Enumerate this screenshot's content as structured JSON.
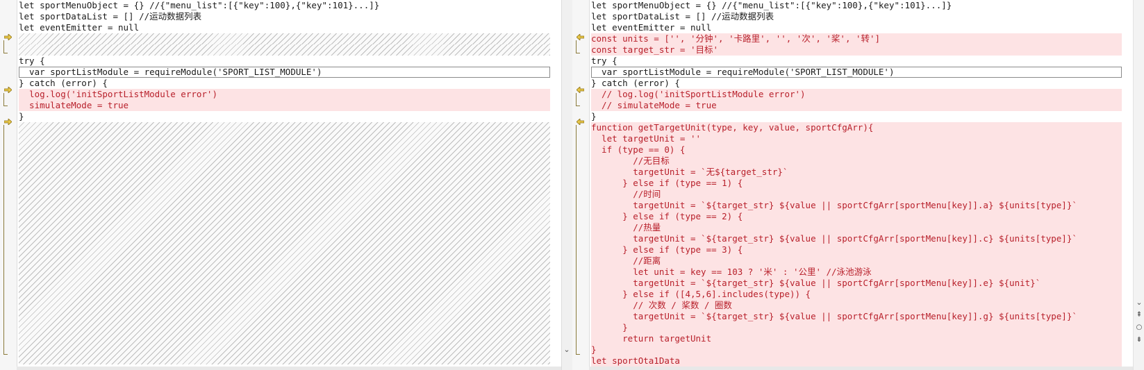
{
  "left": {
    "lines": [
      {
        "kind": "normal",
        "text": "let sportMenuObject = {} //{\"menu_list\":[{\"key\":100},{\"key\":101}...]}"
      },
      {
        "kind": "normal",
        "text": "let sportDataList = [] //运动数据列表"
      },
      {
        "kind": "normal",
        "text": "let eventEmitter = null"
      },
      {
        "kind": "filler",
        "text": ""
      },
      {
        "kind": "filler",
        "text": ""
      },
      {
        "kind": "normal",
        "text": "try {"
      },
      {
        "kind": "cursor",
        "text": "  var sportListModule = requireModule('SPORT_LIST_MODULE')"
      },
      {
        "kind": "normal",
        "text": "} catch (error) {"
      },
      {
        "kind": "diff",
        "text": "  log.log('initSportListModule error')"
      },
      {
        "kind": "diff",
        "text": "  simulateMode = true"
      },
      {
        "kind": "normal",
        "text": "}"
      },
      {
        "kind": "filler-big",
        "text": ""
      }
    ]
  },
  "right": {
    "lines": [
      {
        "kind": "normal",
        "text": "let sportMenuObject = {} //{\"menu_list\":[{\"key\":100},{\"key\":101}...]}"
      },
      {
        "kind": "normal",
        "text": "let sportDataList = [] //运动数据列表"
      },
      {
        "kind": "normal",
        "text": "let eventEmitter = null"
      },
      {
        "kind": "diff",
        "text": "const units = ['', '分钟', '卡路里', '', '次', '桨', '转']"
      },
      {
        "kind": "diff",
        "text": "const target_str = '目标'"
      },
      {
        "kind": "normal",
        "text": "try {"
      },
      {
        "kind": "cursor",
        "text": "  var sportListModule = requireModule('SPORT_LIST_MODULE')"
      },
      {
        "kind": "normal",
        "text": "} catch (error) {"
      },
      {
        "kind": "diff",
        "text": "  // log.log('initSportListModule error')"
      },
      {
        "kind": "diff",
        "text": "  // simulateMode = true"
      },
      {
        "kind": "normal",
        "text": "}"
      },
      {
        "kind": "diff",
        "text": "function getTargetUnit(type, key, value, sportCfgArr){"
      },
      {
        "kind": "diff",
        "text": "  let targetUnit = ''"
      },
      {
        "kind": "diff",
        "text": "  if (type == 0) {"
      },
      {
        "kind": "diff",
        "text": "        //无目标"
      },
      {
        "kind": "diff",
        "text": "        targetUnit = `无${target_str}`"
      },
      {
        "kind": "diff",
        "text": "      } else if (type == 1) {"
      },
      {
        "kind": "diff",
        "text": "        //时间"
      },
      {
        "kind": "diff",
        "text": "        targetUnit = `${target_str} ${value || sportCfgArr[sportMenu[key]].a} ${units[type]}`"
      },
      {
        "kind": "diff",
        "text": "      } else if (type == 2) {"
      },
      {
        "kind": "diff",
        "text": "        //热量"
      },
      {
        "kind": "diff",
        "text": "        targetUnit = `${target_str} ${value || sportCfgArr[sportMenu[key]].c} ${units[type]}`"
      },
      {
        "kind": "diff",
        "text": "      } else if (type == 3) {"
      },
      {
        "kind": "diff",
        "text": "        //距离"
      },
      {
        "kind": "diff",
        "text": "        let unit = key == 103 ? '米' : '公里' //泳池游泳"
      },
      {
        "kind": "diff",
        "text": "        targetUnit = `${target_str} ${value || sportCfgArr[sportMenu[key]].e} ${unit}`"
      },
      {
        "kind": "diff",
        "text": "      } else if ([4,5,6].includes(type)) {"
      },
      {
        "kind": "diff",
        "text": "        // 次数 / 桨数 / 圈数"
      },
      {
        "kind": "diff",
        "text": "        targetUnit = `${target_str} ${value || sportCfgArr[sportMenu[key]].g} ${units[type]}`"
      },
      {
        "kind": "diff",
        "text": "      }"
      },
      {
        "kind": "diff",
        "text": "      return targetUnit"
      },
      {
        "kind": "diff",
        "text": "}"
      },
      {
        "kind": "diff",
        "text": "let sportOta1Data"
      }
    ]
  },
  "colors": {
    "diff_background": "#fde3e4",
    "diff_text": "#b8202b",
    "marker_arrow": "#e8c84a"
  },
  "icons": {
    "left_markers": [
      "arrow-right-icon",
      "arrow-right-icon",
      "arrow-right-icon"
    ],
    "right_markers": [
      "arrow-left-icon",
      "arrow-left-icon",
      "arrow-left-icon"
    ],
    "scrollbar": [
      "chevron-down-icon",
      "chevron-down-icon",
      "scroll-prev-change-icon",
      "scroll-sync-icon",
      "scroll-next-change-icon"
    ]
  }
}
